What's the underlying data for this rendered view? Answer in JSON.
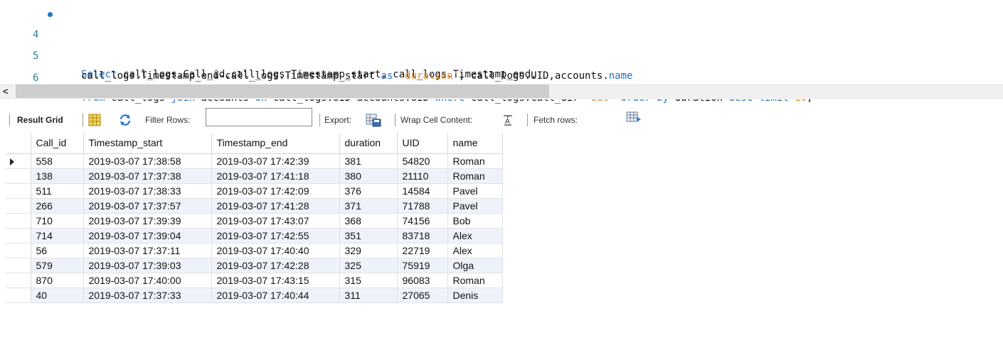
{
  "editor": {
    "lines": [
      {
        "number": "4",
        "has_marker": true
      },
      {
        "number": "5",
        "has_marker": false
      },
      {
        "number": "6",
        "has_marker": false
      }
    ],
    "line4": {
      "kw_select": "Select",
      "t1": " call_logs.Call_id,call_logs.Timestamp_start, call_logs.Timestamp_end,"
    },
    "line5": {
      "t1": "call_logs.Timestamp_end-call_logs.Timestamp_start ",
      "kw_as": "as",
      "sp": " ",
      "str_duration": "'duration'",
      "t2": ", call_logs.UID,accounts.",
      "kw_name": "name"
    },
    "line6": {
      "kw_from": "from",
      "t1": " call_logs ",
      "kw_join": "join",
      "t2": " accounts ",
      "kw_on": "on",
      "t3": " call_logs.UID=accounts.UID ",
      "kw_where": "where",
      "t4": " call_logs.Call_dir=",
      "str_out": "'out'",
      "t5": " ",
      "kw_order": "order",
      "t6": " ",
      "kw_by": "by",
      "t7": " duration ",
      "kw_desc": "desc",
      "t8": " ",
      "kw_limit": "limit",
      "t9": " ",
      "num_10": "10",
      "t10": ";"
    }
  },
  "scrollbar": {
    "left_arrow": "<"
  },
  "toolbar": {
    "result_grid_label": "Result Grid",
    "filter_rows_label": "Filter Rows:",
    "filter_rows_value": "",
    "export_label": "Export:",
    "wrap_cell_label": "Wrap Cell Content:",
    "fetch_rows_label": "Fetch rows:"
  },
  "grid": {
    "columns": [
      "Call_id",
      "Timestamp_start",
      "Timestamp_end",
      "duration",
      "UID",
      "name"
    ],
    "rows": [
      [
        "558",
        "2019-03-07 17:38:58",
        "2019-03-07 17:42:39",
        "381",
        "54820",
        "Roman"
      ],
      [
        "138",
        "2019-03-07 17:37:38",
        "2019-03-07 17:41:18",
        "380",
        "21110",
        "Roman"
      ],
      [
        "511",
        "2019-03-07 17:38:33",
        "2019-03-07 17:42:09",
        "376",
        "14584",
        "Pavel"
      ],
      [
        "266",
        "2019-03-07 17:37:57",
        "2019-03-07 17:41:28",
        "371",
        "71788",
        "Pavel"
      ],
      [
        "710",
        "2019-03-07 17:39:39",
        "2019-03-07 17:43:07",
        "368",
        "74156",
        "Bob"
      ],
      [
        "714",
        "2019-03-07 17:39:04",
        "2019-03-07 17:42:55",
        "351",
        "83718",
        "Alex"
      ],
      [
        "56",
        "2019-03-07 17:37:11",
        "2019-03-07 17:40:40",
        "329",
        "22719",
        "Alex"
      ],
      [
        "579",
        "2019-03-07 17:39:03",
        "2019-03-07 17:42:28",
        "325",
        "75919",
        "Olga"
      ],
      [
        "870",
        "2019-03-07 17:40:00",
        "2019-03-07 17:43:15",
        "315",
        "96083",
        "Roman"
      ],
      [
        "40",
        "2019-03-07 17:37:33",
        "2019-03-07 17:40:44",
        "311",
        "27065",
        "Denis"
      ]
    ]
  },
  "colors": {
    "keyword": "#1f6fc4",
    "string": "#e3841c",
    "line_number": "#2e7d9a",
    "row_alt": "#eef3fb"
  },
  "icons": {
    "statement_marker": "breakpoint-dot-icon",
    "result_grid": "grid-layout-icon",
    "refresh": "refresh-icon",
    "export": "export-icon",
    "wrap": "wrap-text-icon",
    "fetch": "fetch-rows-icon"
  }
}
